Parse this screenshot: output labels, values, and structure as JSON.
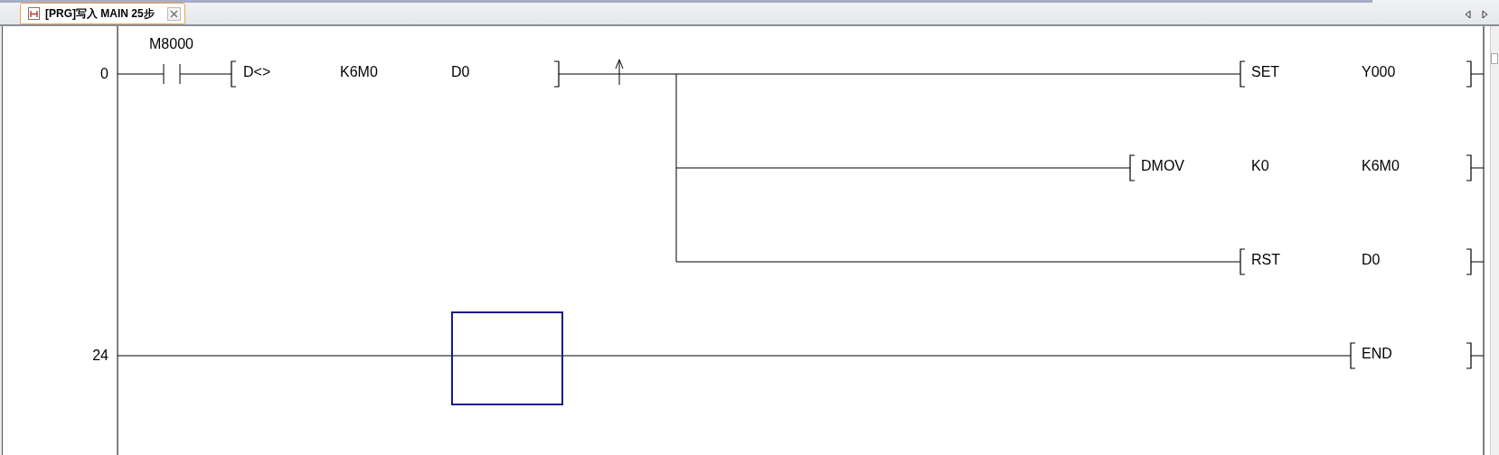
{
  "tab": {
    "title": "[PRG]写入 MAIN 25步",
    "selected": true
  },
  "rungs": [
    {
      "step": "0",
      "contact": {
        "device": "M8000"
      },
      "compare": {
        "op": "D<>",
        "operands": [
          "K6M0",
          "D0"
        ]
      },
      "rising_edge": true,
      "outputs": [
        {
          "instruction": "SET",
          "operands": [
            "Y000"
          ]
        },
        {
          "instruction": "DMOV",
          "operands": [
            "K0",
            "K6M0"
          ]
        },
        {
          "instruction": "RST",
          "operands": [
            "D0"
          ]
        }
      ]
    },
    {
      "step": "24",
      "outputs": [
        {
          "instruction": "END"
        }
      ]
    }
  ]
}
